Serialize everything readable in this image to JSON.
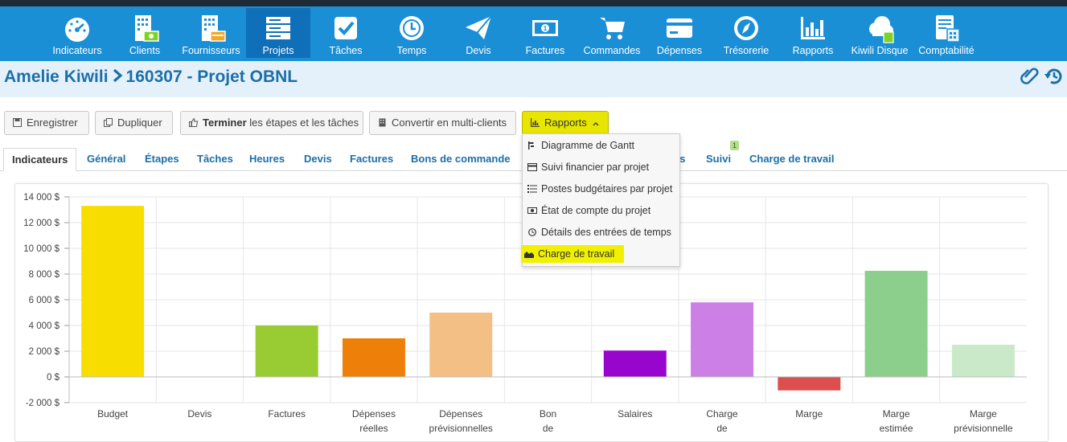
{
  "nav": {
    "items": [
      {
        "label": "Indicateurs",
        "icon": "speedometer-icon"
      },
      {
        "label": "Clients",
        "icon": "building-money-icon"
      },
      {
        "label": "Fournisseurs",
        "icon": "building-card-icon"
      },
      {
        "label": "Projets",
        "icon": "server-stack-icon"
      },
      {
        "label": "Tâches",
        "icon": "checkbox-icon"
      },
      {
        "label": "Temps",
        "icon": "clock-icon"
      },
      {
        "label": "Devis",
        "icon": "paper-plane-icon"
      },
      {
        "label": "Factures",
        "icon": "banknote-icon"
      },
      {
        "label": "Commandes",
        "icon": "cart-icon"
      },
      {
        "label": "Dépenses",
        "icon": "credit-card-icon"
      },
      {
        "label": "Trésorerie",
        "icon": "compass-icon"
      },
      {
        "label": "Rapports",
        "icon": "bar-chart-icon"
      },
      {
        "label": "Kiwili Disque",
        "icon": "cloud-icon"
      },
      {
        "label": "Comptabilité",
        "icon": "ledger-calculator-icon"
      }
    ],
    "active": "Projets"
  },
  "breadcrumb": {
    "client": "Amelie Kiwili",
    "project": "160307 - Projet OBNL"
  },
  "toolbar": {
    "save_label": "Enregistrer",
    "duplicate_label": "Dupliquer",
    "finish_bold": "Terminer",
    "finish_rest": "les étapes et les tâches",
    "convert_label": "Convertir en multi-clients",
    "reports_label": "Rapports"
  },
  "tabs": [
    "Indicateurs",
    "Général",
    "Étapes",
    "Tâches",
    "Heures",
    "Devis",
    "Factures",
    "Bons de commande",
    "es",
    "Suivi",
    "Charge de travail"
  ],
  "tab_badge": "1",
  "reports_menu": [
    "Diagramme de Gantt",
    "Suivi financier par projet",
    "Postes budgétaires par projet",
    "État de compte du projet",
    "Détails des entrées de temps",
    "Charge de travail"
  ],
  "colors": {
    "nav_bg": "#1a8fd6",
    "nav_active": "#0f6fb8",
    "highlight": "#f1f000",
    "link": "#1c6fa8"
  },
  "chart_data": {
    "type": "bar",
    "y_ticks": [
      "14 000 $",
      "12 000 $",
      "10 000 $",
      "8 000 $",
      "6 000 $",
      "4 000 $",
      "2 000 $",
      "0 $",
      "-2 000 $"
    ],
    "ylim": [
      -2000,
      14000
    ],
    "grid": true,
    "categories": [
      [
        "Budget"
      ],
      [
        "Devis"
      ],
      [
        "Factures"
      ],
      [
        "Dépenses",
        "réelles"
      ],
      [
        "Dépenses",
        "prévisionnelles"
      ],
      [
        "Bon",
        "de"
      ],
      [
        "Salaires"
      ],
      [
        "Charge",
        "de"
      ],
      [
        "Marge"
      ],
      [
        "Marge",
        "estimée"
      ],
      [
        "Marge",
        "prévisionnelle"
      ]
    ],
    "values": [
      13300,
      0,
      4000,
      3000,
      5000,
      0,
      2050,
      5800,
      -1050,
      8250,
      2500
    ],
    "colors": [
      "#f7dd00",
      "#cccccc",
      "#98cc32",
      "#ee8009",
      "#f4bf85",
      "#cccccc",
      "#9805cc",
      "#cc80e6",
      "#db4f4f",
      "#8ccf8c",
      "#c9e9c9"
    ]
  }
}
